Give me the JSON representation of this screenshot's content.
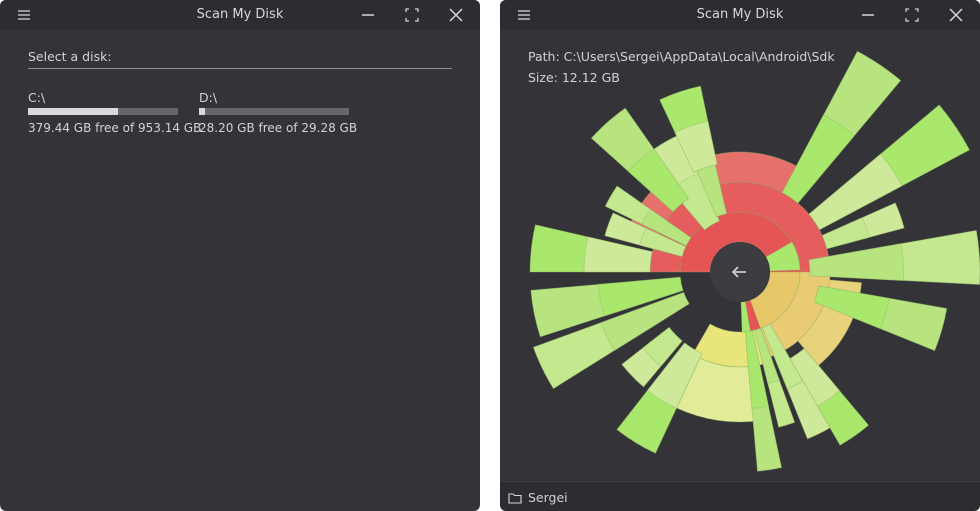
{
  "windows": [
    {
      "title": "Scan My Disk",
      "select_label": "Select a disk:",
      "disks": [
        {
          "name": "C:\\",
          "info": "379.44 GB free of 953.14 GB",
          "used_fraction": 0.6
        },
        {
          "name": "D:\\",
          "info": "28.20 GB free of 29.28 GB",
          "used_fraction": 0.04
        }
      ]
    },
    {
      "title": "Scan My Disk",
      "path_text": "Path: C:\\Users\\Sergei\\AppData\\Local\\Android\\Sdk",
      "size_text": "Size: 12.12 GB",
      "back_icon": "arrow-left-icon",
      "status": {
        "icon": "folder-icon",
        "label": "Sergei"
      }
    }
  ],
  "icons": {
    "menu": "hamburger-menu-icon",
    "minimize": "minimize-icon",
    "maximize": "maximize-icon",
    "close": "close-icon"
  },
  "colors": {
    "window_bg": "#343438",
    "titlebar_bg": "#2d2d31",
    "text": "#d2d3d6",
    "bar_track": "#66676b",
    "bar_fill": "#d9dadc",
    "center_button": "#3c3c40",
    "sunburst_red": "#e65a5a",
    "sunburst_green": "#b6e58a",
    "sunburst_yellow": "#e8e37a"
  }
}
